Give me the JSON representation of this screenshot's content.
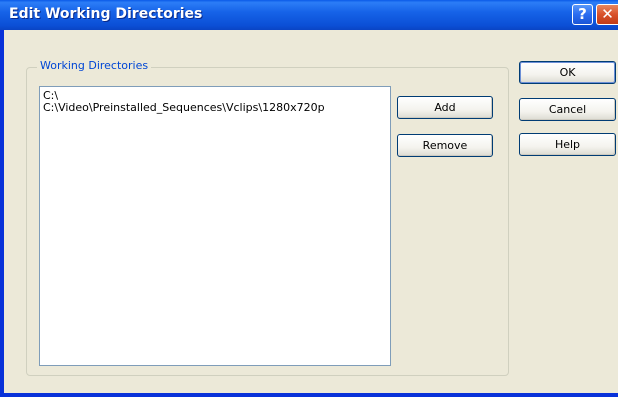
{
  "window": {
    "title": "Edit Working Directories",
    "help_glyph": "?",
    "close_glyph": "✕"
  },
  "group": {
    "label": "Working Directories",
    "items": [
      {
        "path": "C:\\"
      },
      {
        "path": "C:\\Video\\Preinstalled_Sequences\\Vclips\\1280x720p"
      }
    ]
  },
  "buttons": {
    "add": "Add",
    "remove": "Remove",
    "ok": "OK",
    "cancel": "Cancel",
    "help": "Help"
  },
  "colors": {
    "title_bar": "#0b4fd6",
    "dialog_bg": "#ece9d8",
    "group_label": "#0046d5",
    "close_button": "#d9512a"
  }
}
